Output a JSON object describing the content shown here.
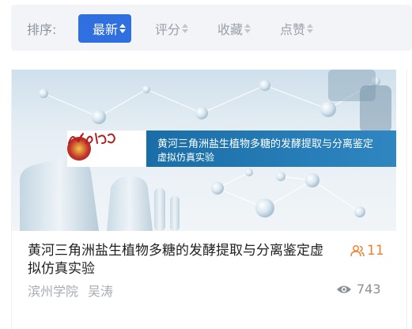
{
  "sort": {
    "label": "排序:",
    "options": [
      {
        "label": "最新",
        "active": true
      },
      {
        "label": "评分",
        "active": false
      },
      {
        "label": "收藏",
        "active": false
      },
      {
        "label": "点赞",
        "active": false
      }
    ]
  },
  "card": {
    "banner": {
      "logo_text": "滨州学院",
      "line1": "黄河三角洲盐生植物多糖的发酵提取与分离鉴定",
      "line2": "虚拟仿真实验"
    },
    "title": "黄河三角洲盐生植物多糖的发酵提取与分离鉴定虚拟仿真实验",
    "member_count": "11",
    "institution": "滨州学院",
    "author": "吴涛",
    "views": "743",
    "icons": {
      "members": "users-icon",
      "views": "eye-icon"
    }
  },
  "colors": {
    "accent": "#2f6fe0",
    "member_orange": "#f08030",
    "banner_blue": "#1a6ea8"
  }
}
